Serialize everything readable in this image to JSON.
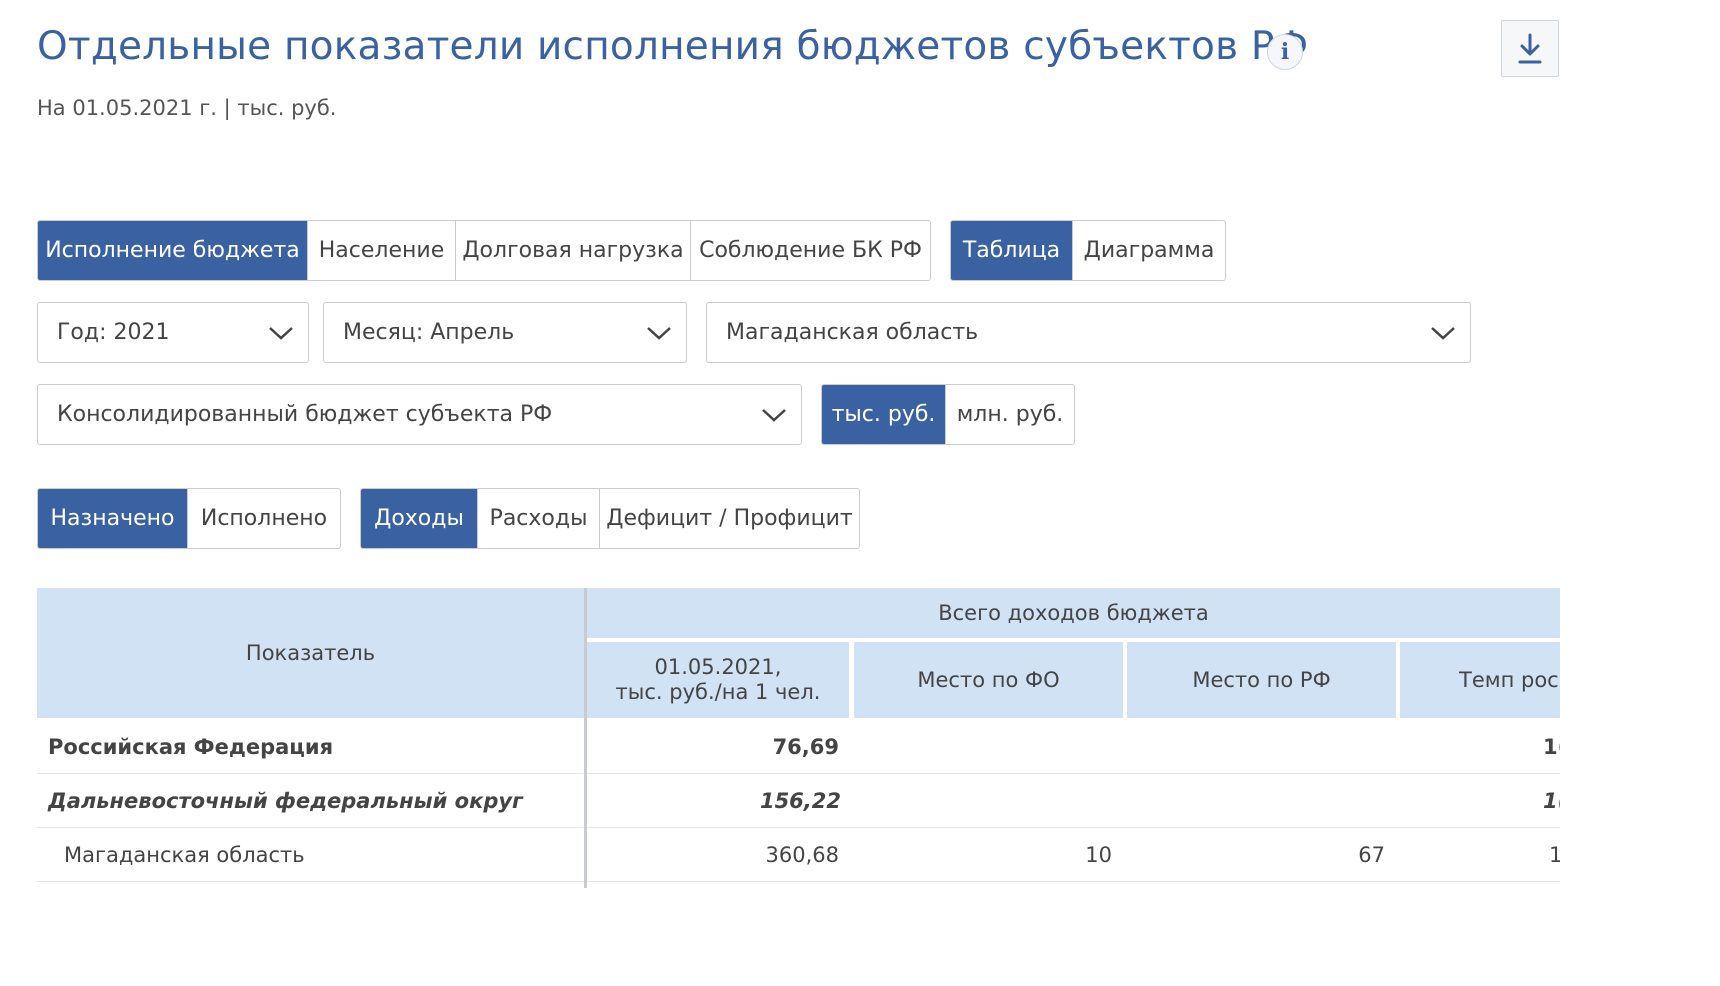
{
  "header": {
    "title": "Отдельные показатели исполнения бюджетов субъектов РФ",
    "info_glyph": "i",
    "subtitle": "На 01.05.2021 г. | тыс. руб."
  },
  "tabs_section": {
    "items": [
      "Исполнение бюджета",
      "Население",
      "Долговая нагрузка",
      "Соблюдение БК РФ"
    ],
    "active": "Исполнение бюджета"
  },
  "view_toggle": {
    "items": [
      "Таблица",
      "Диаграмма"
    ],
    "active": "Таблица"
  },
  "filters": {
    "year": "Год: 2021",
    "month": "Месяц: Апрель",
    "region": "Магаданская область",
    "budget": "Консолидированный бюджет субъекта РФ"
  },
  "unit_toggle": {
    "items": [
      "тыс. руб.",
      "млн. руб."
    ],
    "active": "тыс. руб."
  },
  "status_toggle": {
    "items": [
      "Назначено",
      "Исполнено"
    ],
    "active": "Назначено"
  },
  "type_toggle": {
    "items": [
      "Доходы",
      "Расходы",
      "Дефицит / Профицит"
    ],
    "active": "Доходы"
  },
  "table": {
    "indicator_header": "Показатель",
    "group_header": "Всего доходов бюджета",
    "columns": [
      "01.05.2021,\nтыс. руб./на 1 чел.",
      "Место по ФО",
      "Место по РФ",
      "Темп рос"
    ],
    "rows": [
      {
        "name": "Российская Федерация",
        "value": "76,69",
        "fo": "",
        "rf": "",
        "growth": "1("
      },
      {
        "name": "Дальневосточный федеральный округ",
        "value": "156,22",
        "fo": "",
        "rf": "",
        "growth": "1("
      },
      {
        "name": "Магаданская область",
        "value": "360,68",
        "fo": "10",
        "rf": "67",
        "growth": "1"
      }
    ]
  },
  "colors": {
    "accent": "#3a62a3",
    "header_bg": "#d2e2f5"
  },
  "icons": {
    "info": "info-icon",
    "download": "download-icon",
    "dropdown": "chevron-down-icon"
  }
}
